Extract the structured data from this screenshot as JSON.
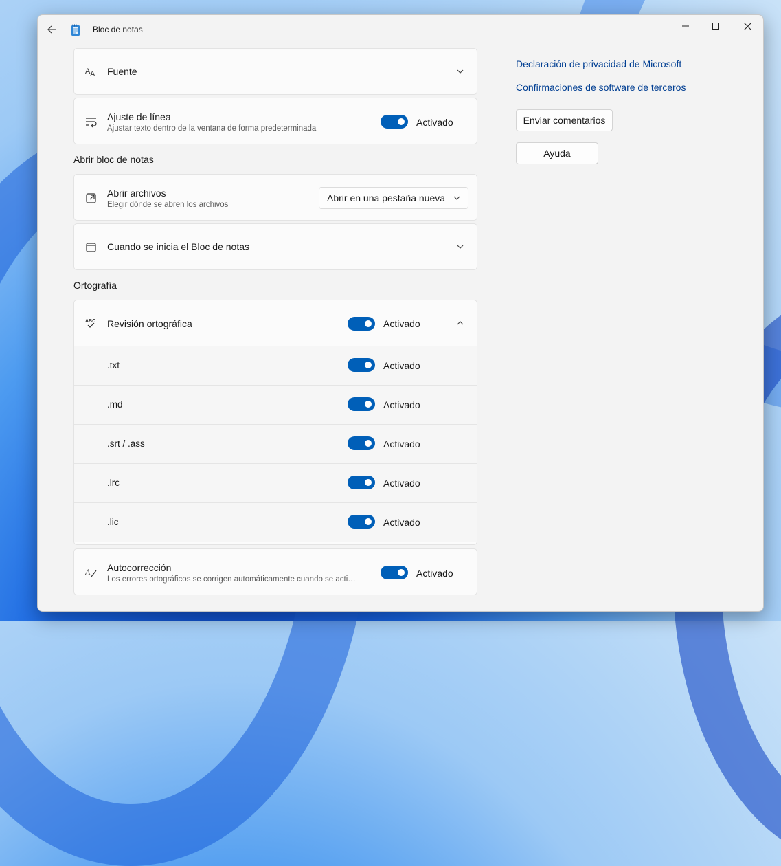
{
  "window": {
    "title": "Bloc de notas"
  },
  "font_card": {
    "label": "Fuente"
  },
  "wrap_card": {
    "label": "Ajuste de línea",
    "desc": "Ajustar texto dentro de la ventana de forma predeterminada",
    "state": "Activado"
  },
  "section_open": "Abrir bloc de notas",
  "open_files": {
    "label": "Abrir archivos",
    "desc": "Elegir dónde se abren los archivos",
    "selected": "Abrir en una pestaña nueva"
  },
  "startup": {
    "label": "Cuando se inicia el Bloc de notas"
  },
  "section_spelling": "Ortografía",
  "spellcheck": {
    "label": "Revisión ortográfica",
    "state": "Activado",
    "items": [
      {
        "label": ".txt",
        "state": "Activado"
      },
      {
        "label": ".md",
        "state": "Activado"
      },
      {
        "label": ".srt / .ass",
        "state": "Activado"
      },
      {
        "label": ".lrc",
        "state": "Activado"
      },
      {
        "label": ".lic",
        "state": "Activado"
      }
    ]
  },
  "autocorrect": {
    "label": "Autocorrección",
    "desc": "Los errores ortográficos se corrigen automáticamente cuando se acti…",
    "state": "Activado"
  },
  "side": {
    "privacy_link": "Declaración de privacidad de Microsoft",
    "thirdparty_link": "Confirmaciones de software de terceros",
    "feedback_button": "Enviar comentarios",
    "help_button": "Ayuda"
  },
  "colors": {
    "accent": "#005fb8",
    "link": "#003e92"
  }
}
